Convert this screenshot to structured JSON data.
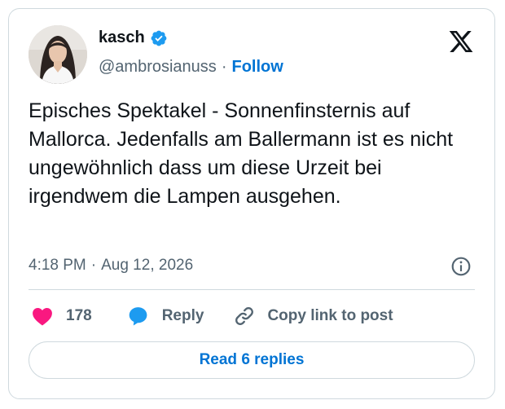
{
  "author": {
    "display_name": "kasch",
    "handle": "@ambrosianuss",
    "separator": "·",
    "follow_label": "Follow",
    "verified": true
  },
  "icons": {
    "brand": "x-logo-icon",
    "verified": "verified-badge-icon",
    "info": "info-icon",
    "like": "heart-icon",
    "reply": "speech-bubble-icon",
    "copy": "link-icon"
  },
  "tweet": {
    "text": "Episches Spektakel - Sonnenfinsternis auf Mallorca. Jedenfalls am Ballermann ist es nicht ungewöhnlich dass um diese Urzeit bei irgendwem die Lampen ausgehen.",
    "time": "4:18 PM",
    "separator": "·",
    "date": "Aug 12, 2026"
  },
  "actions": {
    "like_count": "178",
    "reply_label": "Reply",
    "copy_label": "Copy link to post"
  },
  "footer": {
    "read_replies_label": "Read 6 replies"
  },
  "colors": {
    "accent": "#0074d4",
    "verified": "#1d9bf0",
    "like": "#f91880",
    "text_primary": "#0f1419",
    "text_secondary": "#536471",
    "border": "#cfd9de"
  }
}
